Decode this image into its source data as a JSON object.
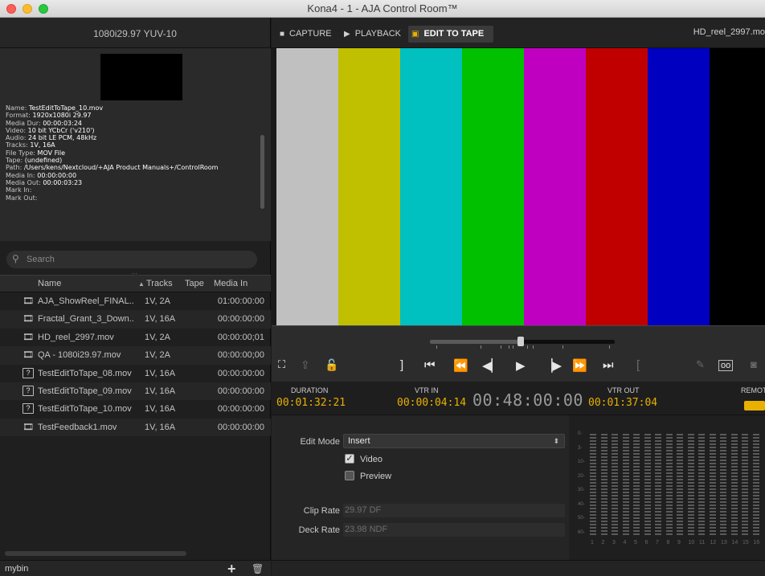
{
  "window": {
    "title": "Kona4 - 1 - AJA Control Room™"
  },
  "left_header": "1080i29.97 YUV-10",
  "clip_info": [
    {
      "label": "Name: ",
      "value": "TestEditToTape_10.mov"
    },
    {
      "label": "Format: ",
      "value": "1920x1080i 29.97"
    },
    {
      "label": "Media Dur: ",
      "value": "00:00:03:24"
    },
    {
      "label": "Video: ",
      "value": "10 bit YCbCr ('v210')"
    },
    {
      "label": "Audio: ",
      "value": "24 bit LE PCM, 48kHz"
    },
    {
      "label": "Tracks: ",
      "value": "1V, 16A"
    },
    {
      "label": "File Type: ",
      "value": "MOV File"
    },
    {
      "label": "Tape: ",
      "value": "(undefined)"
    },
    {
      "label": "Path: ",
      "value": "/Users/kens/Nextcloud/+AJA Product Manuals+/ControlRoom"
    },
    {
      "label": "Media In: ",
      "value": "00:00:00:00"
    },
    {
      "label": "Media Out: ",
      "value": "00:00:03:23"
    },
    {
      "label": "Mark In:",
      "value": ""
    },
    {
      "label": "Mark Out:",
      "value": ""
    }
  ],
  "grip": "···",
  "search": {
    "placeholder": "Search"
  },
  "table": {
    "headers": {
      "name": "Name",
      "tracks": "Tracks",
      "tape": "Tape",
      "media_in": "Media In"
    },
    "rows": [
      {
        "icon": "film-icon",
        "name": "AJA_ShowReel_FINAL....",
        "tracks": "1V, 2A",
        "media_in": "01:00:00:00"
      },
      {
        "icon": "film-icon",
        "name": "Fractal_Grant_3_Down...",
        "tracks": "1V, 16A",
        "media_in": "00:00:00:00"
      },
      {
        "icon": "film-icon",
        "name": "HD_reel_2997.mov",
        "tracks": "1V, 2A",
        "media_in": "00:00:00;01"
      },
      {
        "icon": "film-icon",
        "name": "QA - 1080i29.97.mov",
        "tracks": "1V, 2A",
        "media_in": "00:00:00;00"
      },
      {
        "icon": "unknown-file-icon",
        "name": "TestEditToTape_08.mov",
        "tracks": "1V, 16A",
        "media_in": "00:00:00:00"
      },
      {
        "icon": "unknown-file-icon",
        "name": "TestEditToTape_09.mov",
        "tracks": "1V, 16A",
        "media_in": "00:00:00:00"
      },
      {
        "icon": "unknown-file-icon",
        "name": "TestEditToTape_10.mov",
        "tracks": "1V, 16A",
        "media_in": "00:00:00:00"
      },
      {
        "icon": "film-icon",
        "name": "TestFeedback1.mov",
        "tracks": "1V, 16A",
        "media_in": "00:00:00:00"
      }
    ]
  },
  "bin": {
    "name": "mybin"
  },
  "tabs": [
    {
      "label": "CAPTURE",
      "icon": "camera-icon",
      "glyph": "■"
    },
    {
      "label": "PLAYBACK",
      "icon": "play-icon",
      "glyph": "▶"
    },
    {
      "label": "EDIT TO TAPE",
      "icon": "tape-icon",
      "glyph": "▣",
      "active": true
    }
  ],
  "file_title": "HD_reel_2997.mo",
  "color_bars": [
    "#c0c0c0",
    "#c0c000",
    "#00c0c0",
    "#00c000",
    "#c000c0",
    "#c00000",
    "#0000c0",
    "#000000"
  ],
  "timecodes": {
    "duration_label": "DURATION",
    "duration": "00:01:32:21",
    "vtr_in_label": "VTR IN",
    "vtr_in": "00:00:04:14",
    "current": "00:48:00:00",
    "vtr_out_label": "VTR OUT",
    "vtr_out": "00:01:37:04",
    "remote_label": "REMOTI"
  },
  "settings": {
    "edit_mode_label": "Edit Mode",
    "edit_mode_value": "Insert",
    "video_label": "Video",
    "video_checked": true,
    "preview_label": "Preview",
    "preview_checked": false,
    "clip_rate_label": "Clip Rate",
    "clip_rate_value": "29.97 DF",
    "deck_rate_label": "Deck Rate",
    "deck_rate_value": "23.98 NDF"
  },
  "meters": {
    "scale": [
      "0-",
      "3-",
      "10-",
      "20-",
      "30-",
      "40-",
      "50-",
      "60-"
    ],
    "channels": [
      "1",
      "2",
      "3",
      "4",
      "5",
      "6",
      "7",
      "8",
      "9",
      "10",
      "11",
      "12",
      "13",
      "14",
      "15",
      "16"
    ]
  },
  "accent_color": "#e8b100"
}
